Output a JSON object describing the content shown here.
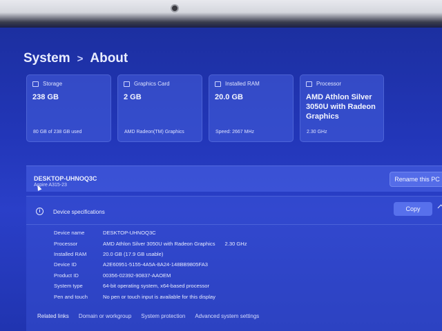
{
  "breadcrumb": {
    "parent": "System",
    "separator": ">",
    "current": "About"
  },
  "cards": [
    {
      "label": "Storage",
      "value": "238 GB",
      "sub": "80 GB of 238 GB used",
      "icon": "storage-icon"
    },
    {
      "label": "Graphics Card",
      "value": "2 GB",
      "sub": "AMD Radeon(TM) Graphics",
      "icon": "graphics-card-icon"
    },
    {
      "label": "Installed RAM",
      "value": "20.0 GB",
      "sub": "Speed: 2667 MHz",
      "icon": "ram-icon"
    },
    {
      "label": "Processor",
      "value": "AMD Athlon Silver 3050U with Radeon Graphics",
      "sub": "2.30 GHz",
      "icon": "processor-icon"
    }
  ],
  "pc": {
    "name": "DESKTOP-UHNOQ3C",
    "model": "Aspire A315-23",
    "rename_label": "Rename this PC"
  },
  "specs": {
    "title": "Device specifications",
    "copy_label": "Copy",
    "rows": [
      {
        "label": "Device name",
        "value": "DESKTOP-UHNOQ3C",
        "extra": ""
      },
      {
        "label": "Processor",
        "value": "AMD Athlon Silver 3050U with Radeon Graphics",
        "extra": "2.30 GHz"
      },
      {
        "label": "Installed RAM",
        "value": "20.0 GB (17.9 GB usable)",
        "extra": ""
      },
      {
        "label": "Device ID",
        "value": "A2E60951-5155-4A5A-8A24-148BB9805FA3",
        "extra": ""
      },
      {
        "label": "Product ID",
        "value": "00356-02392-90837-AAOEM",
        "extra": ""
      },
      {
        "label": "System type",
        "value": "64-bit operating system, x64-based processor",
        "extra": ""
      },
      {
        "label": "Pen and touch",
        "value": "No pen or touch input is available for this display",
        "extra": ""
      }
    ]
  },
  "related": {
    "lead": "Related links",
    "links": [
      "Domain or workgroup",
      "System protection",
      "Advanced system settings"
    ]
  },
  "colors": {
    "background": "#2236b8",
    "card": "#4a62dc",
    "text": "#f2f4ff"
  }
}
